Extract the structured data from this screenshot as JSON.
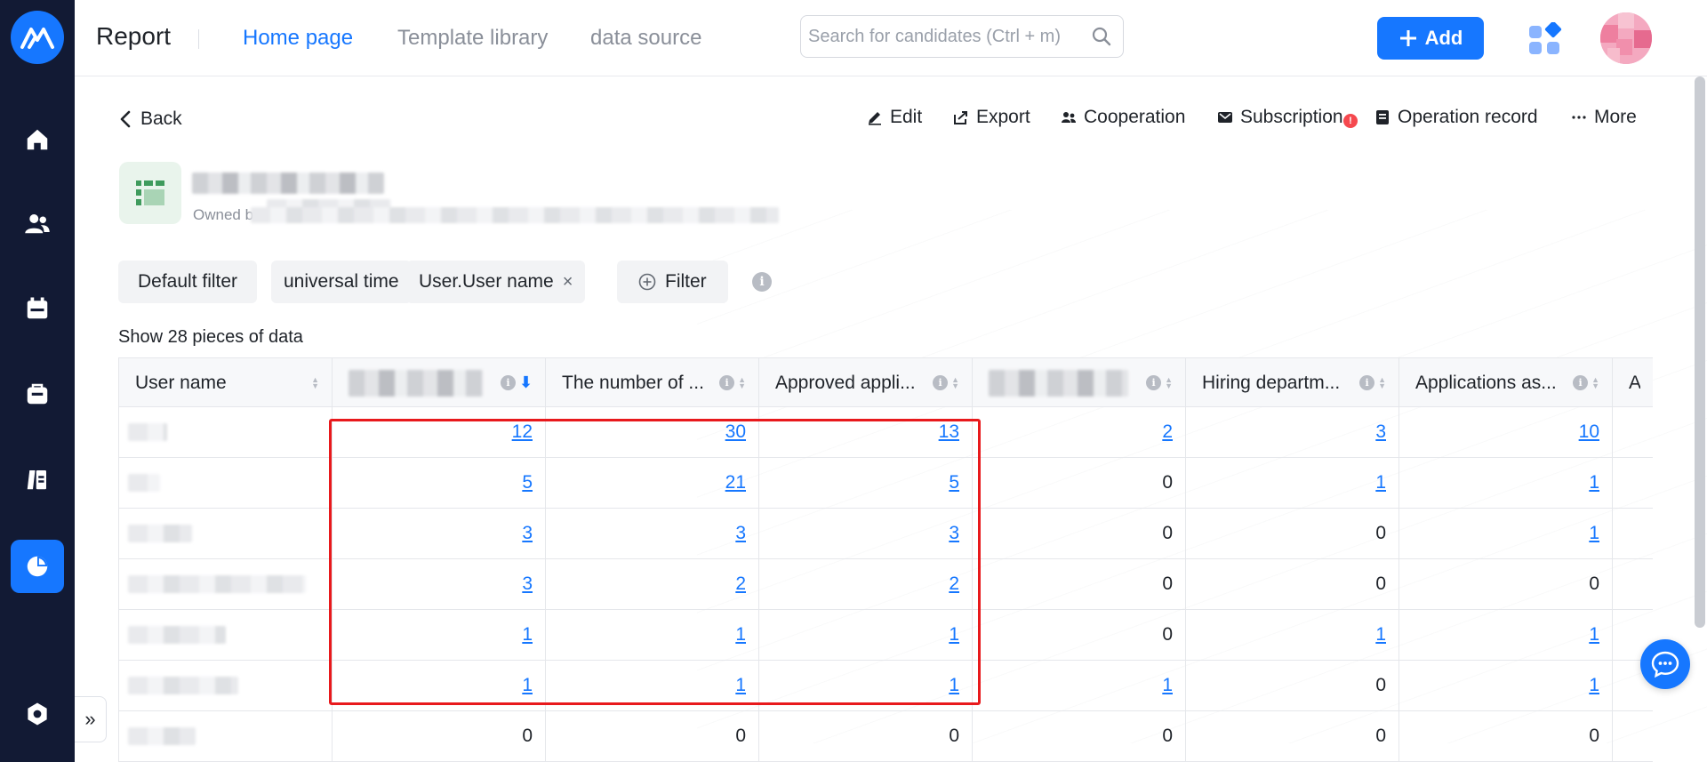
{
  "header": {
    "app_title": "Report",
    "tabs": [
      {
        "label": "Home page",
        "active": true
      },
      {
        "label": "Template library",
        "active": false
      },
      {
        "label": "data source",
        "active": false
      }
    ],
    "search_placeholder": "Search for candidates (Ctrl + m)",
    "add_label": "Add"
  },
  "sidebar": {
    "items": [
      {
        "icon": "home-icon",
        "active": false
      },
      {
        "icon": "users-icon",
        "active": false
      },
      {
        "icon": "calendar-icon",
        "active": false
      },
      {
        "icon": "briefcase-icon",
        "active": false
      },
      {
        "icon": "library-icon",
        "active": false
      },
      {
        "icon": "pie-chart-icon",
        "active": true
      },
      {
        "icon": "settings-icon",
        "active": false
      }
    ],
    "expand_glyph": "»"
  },
  "toolbar": {
    "back_label": "Back",
    "actions": [
      {
        "label": "Edit",
        "icon": "pencil-icon"
      },
      {
        "label": "Export",
        "icon": "export-icon"
      },
      {
        "label": "Cooperation",
        "icon": "people-icon"
      },
      {
        "label": "Subscription",
        "icon": "mail-icon",
        "badge": "!"
      },
      {
        "label": "Operation record",
        "icon": "record-icon"
      },
      {
        "label": "More",
        "icon": "more-icon"
      }
    ]
  },
  "report": {
    "owned_prefix": "Owned b"
  },
  "filters": {
    "chips": [
      "Default filter",
      "universal time",
      "User.User name"
    ],
    "remove_glyph": "×",
    "filter_button": "Filter",
    "info_glyph": "i"
  },
  "summary": "Show 28 pieces of data",
  "table": {
    "columns": [
      {
        "label": "User name"
      },
      {
        "label": ""
      },
      {
        "label": "The number of ..."
      },
      {
        "label": "Approved appli..."
      },
      {
        "label": ""
      },
      {
        "label": "Hiring departm..."
      },
      {
        "label": "Applications as..."
      },
      {
        "label": "A"
      }
    ],
    "rows": [
      [
        "",
        "12",
        "30",
        "13",
        "2",
        "3",
        "10"
      ],
      [
        "",
        "5",
        "21",
        "5",
        "0",
        "1",
        "1"
      ],
      [
        "",
        "3",
        "3",
        "3",
        "0",
        "0",
        "1"
      ],
      [
        "",
        "3",
        "2",
        "2",
        "0",
        "0",
        "0"
      ],
      [
        "",
        "1",
        "1",
        "1",
        "0",
        "1",
        "1"
      ],
      [
        "",
        "1",
        "1",
        "1",
        "1",
        "0",
        "1"
      ],
      [
        "",
        "0",
        "0",
        "0",
        "0",
        "0",
        "0"
      ]
    ]
  },
  "colors": {
    "primary": "#1677ff",
    "sidebar_bg": "#121a34",
    "highlight": "#e8191c",
    "badge": "#f5484e"
  }
}
